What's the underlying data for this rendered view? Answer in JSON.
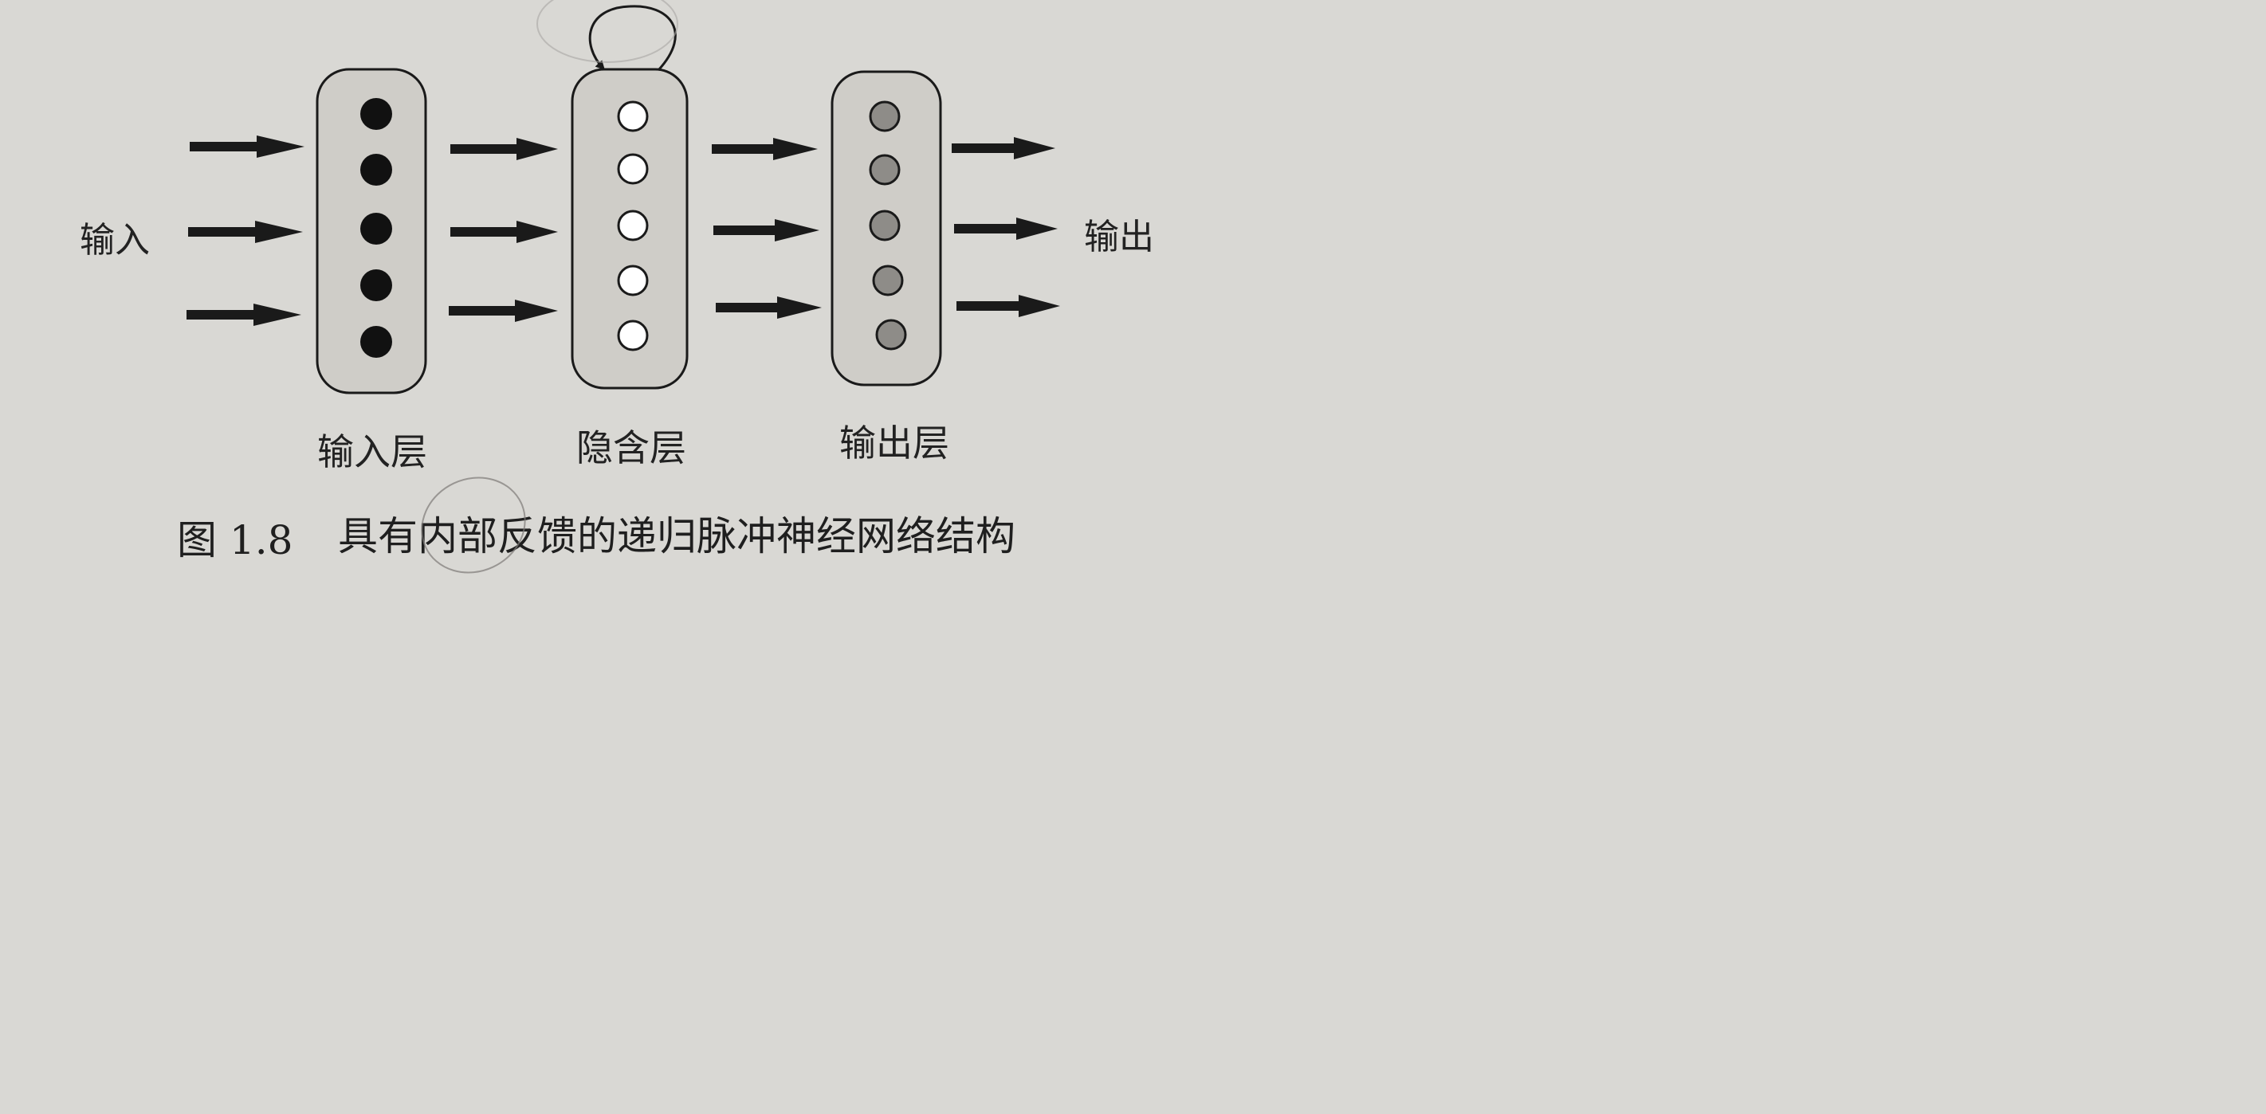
{
  "labels": {
    "input": "输入",
    "output": "输出",
    "input_layer": "输入层",
    "hidden_layer": "隐含层",
    "output_layer": "输出层"
  },
  "caption": {
    "number": "图 1.8",
    "text": "具有内部反馈的递归脉冲神经网络结构"
  },
  "layers": [
    {
      "id": "input",
      "neurons": 5,
      "neuron_style": "filled-black"
    },
    {
      "id": "hidden",
      "neurons": 5,
      "neuron_style": "hollow-white",
      "self_loop": true
    },
    {
      "id": "output",
      "neurons": 5,
      "neuron_style": "filled-gray"
    }
  ],
  "arrows_per_gap": 3,
  "colors": {
    "paper": "#d9d8d4",
    "layer_fill": "#cfcdc8",
    "ink": "#1a1a1a",
    "neuron_black": "#111111",
    "neuron_white": "#ffffff",
    "neuron_gray": "#8e8c88"
  }
}
